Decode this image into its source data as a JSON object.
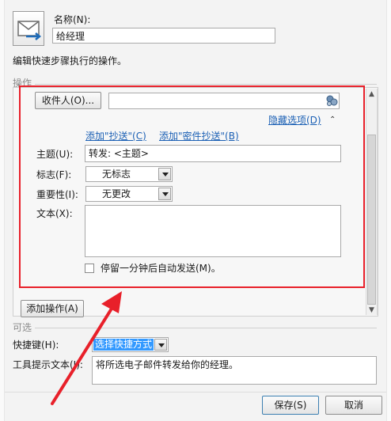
{
  "header": {
    "name_label": "名称(N):",
    "name_value": "给经理",
    "description": "编辑快速步骤执行的操作。"
  },
  "actions": {
    "section_label": "操作",
    "to_button": "收件人(O)...",
    "to_value": "",
    "hide_options_link": "隐藏选项(D)",
    "add_cc_link": "添加\"抄送\"(C)",
    "add_bcc_link": "添加\"密件抄送\"(B)",
    "subject_label": "主题(U):",
    "subject_value": "转发: <主题>",
    "flag_label": "标志(F):",
    "flag_value": "无标志",
    "importance_label": "重要性(I):",
    "importance_value": "无更改",
    "text_label": "文本(X):",
    "text_value": "",
    "auto_send_label": "停留一分钟后自动发送(M)。",
    "auto_send_checked": false,
    "add_action_button": "添加操作(A)"
  },
  "optional": {
    "section_label": "可选",
    "shortcut_label": "快捷键(H):",
    "shortcut_value": "选择快捷方式",
    "tooltip_label": "工具提示文本(I):",
    "tooltip_value": "将所选电子邮件转发给你的经理。"
  },
  "footer": {
    "save_button": "保存(S)",
    "cancel_button": "取消"
  },
  "colors": {
    "annotation_red": "#e8202a",
    "link_blue": "#1a5fb4",
    "selection_blue": "#3399ff"
  }
}
